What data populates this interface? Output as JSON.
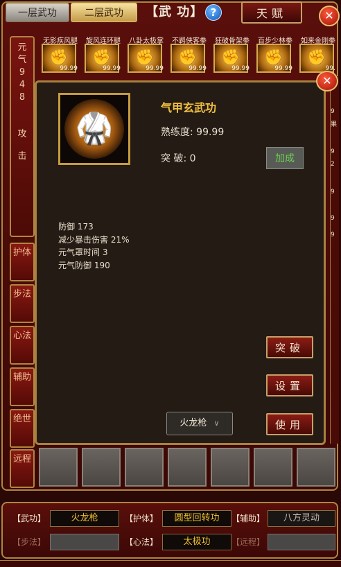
{
  "tabs": [
    {
      "label": "一层武功",
      "active": false
    },
    {
      "label": "二层武功",
      "active": true
    }
  ],
  "header": {
    "title": "【武 功】",
    "help_icon": "?",
    "tianfu_label": "天赋",
    "close_icon": "✕"
  },
  "sidebar": {
    "yuanqi_chars": [
      "元",
      "气",
      "9",
      "4",
      "8"
    ],
    "attack_chars": [
      "攻",
      "击"
    ],
    "categories": [
      {
        "label": "护体"
      },
      {
        "label": "步法"
      },
      {
        "label": "心法"
      },
      {
        "label": "辅助"
      },
      {
        "label": "绝世"
      },
      {
        "label": "远程"
      }
    ]
  },
  "skill_strip": [
    {
      "name": "无影疾风腿",
      "value": "99.99",
      "icon": "fist-icon"
    },
    {
      "name": "旋风连环腿",
      "value": "99.99",
      "icon": "fist-icon"
    },
    {
      "name": "八卦太极掌",
      "value": "99.99",
      "icon": "fist-icon"
    },
    {
      "name": "不羁侠客拳",
      "value": "99.99",
      "icon": "fist-icon"
    },
    {
      "name": "狂破骨架拳",
      "value": "99.99",
      "icon": "fist-icon"
    },
    {
      "name": "百步少林拳",
      "value": "99.99",
      "icon": "fist-icon"
    },
    {
      "name": "如来金刚拳",
      "value": "99.",
      "icon": "fist-icon"
    }
  ],
  "right_numbers": [
    "9",
    "果",
    "9",
    "2",
    "9",
    "9",
    "9"
  ],
  "detail": {
    "title": "气甲玄武功",
    "proficiency": "熟练度: 99.99",
    "breakthrough": "突  破: 0",
    "bonus_label": "加成",
    "stats": [
      "防御 173",
      "减少暴击伤害 21%",
      "元气罩时间 3",
      "元气防御 190"
    ],
    "buttons": {
      "break": "突破",
      "settings": "设置",
      "use": "使用"
    },
    "weapon_select": "火龙枪"
  },
  "equipment": {
    "row1": [
      {
        "label": "【武功】",
        "value": "火龙枪",
        "style": "gold"
      },
      {
        "label": "【护体】",
        "value": "圆型回转功",
        "style": "gold"
      },
      {
        "label": "【辅助】",
        "value": "八方灵动",
        "style": "gray"
      }
    ],
    "row2": [
      {
        "label": "【步法】",
        "value": "",
        "style": "empty",
        "dim": true
      },
      {
        "label": "【心法】",
        "value": "太极功",
        "style": "gold"
      },
      {
        "label": "【远程】",
        "value": "",
        "style": "empty",
        "dim": true
      }
    ]
  },
  "colors": {
    "frame_red": "#5a0f0b",
    "gold_border": "#b08540",
    "title_gold": "#f0c040",
    "bonus_green": "#6ad050"
  }
}
